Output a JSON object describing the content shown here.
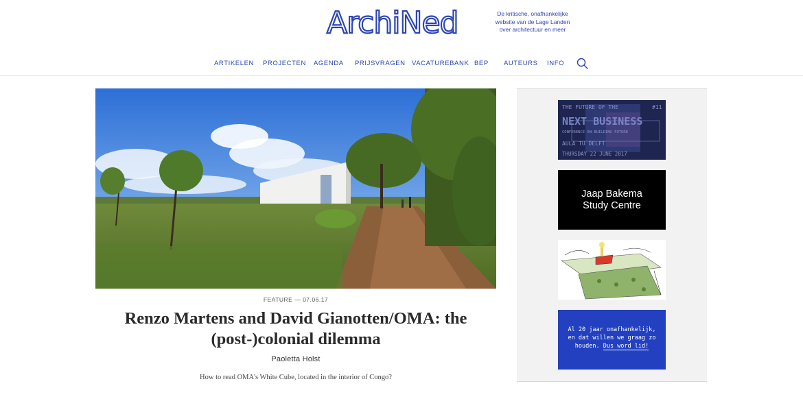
{
  "header": {
    "logo_text": "ArchiNed",
    "tagline": "De kritische, onafhankelijke website van de Lage Landen over architectuur en meer"
  },
  "nav": {
    "items": [
      "ARTIKELEN",
      "PROJECTEN",
      "AGENDA",
      "PRIJSVRAGEN",
      "VACATUREBANK",
      "BEP",
      "AUTEURS",
      "INFO"
    ]
  },
  "article": {
    "meta": "FEATURE — 07.06.17",
    "title_line1": "Renzo Martens and David Gianotten/OMA: the",
    "title_line2": "(post-)colonial dilemma",
    "author": "Paoletta Holst",
    "lead": "How to read OMA's White Cube, located in the interior of Congo?"
  },
  "sidebar": {
    "ad1": {
      "line1": "THE FUTURE OF THE",
      "num": "#11",
      "line2": "NEXT BUSINESS",
      "line3": "CONFERENCE ON BUILDING FUTURE",
      "line4": "AULA TU DELFT",
      "line5": "THURSDAY 22 JUNE 2017"
    },
    "ad2": {
      "line1": "Jaap Bakema",
      "line2": "Study Centre"
    },
    "ad4": {
      "line1": "Al 20 jaar onafhankelijk,",
      "line2": "en dat willen we graag zo",
      "line3_prefix": "houden.",
      "cta": "Dus word lid!"
    }
  },
  "colors": {
    "brand_blue": "#2c45b3",
    "ad_blue": "#2240c0"
  }
}
